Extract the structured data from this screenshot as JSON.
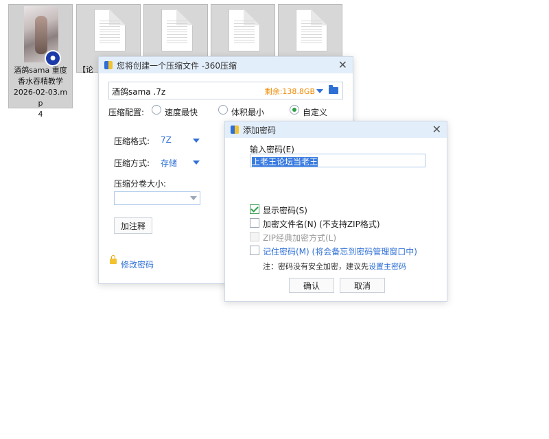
{
  "desktop": {
    "selected_file": {
      "caption_line1": "酒鸽sama 重度",
      "caption_line2": "香水吞精教学",
      "caption_line3": "2026-02-03.mp",
      "caption_line4": "4",
      "icon": "video-thumbnail"
    },
    "doc_tile_partial_caption": "【论",
    "doc_tiles": 4
  },
  "compress_dialog": {
    "title": "您将创建一个压缩文件 -360压缩",
    "archive_name": "酒鸽sama .7z",
    "free_space": "剩余:138.8GB",
    "config_label": "压缩配置:",
    "options": [
      "速度最快",
      "体积最小",
      "自定义"
    ],
    "selected_option": "自定义",
    "format_label": "压缩格式:",
    "format_value": "7Z",
    "method_label": "压缩方式:",
    "method_value": "存储",
    "volume_label": "压缩分卷大小:",
    "volume_value": "",
    "comment_button": "加注释",
    "modify_password": "修改密码"
  },
  "password_dialog": {
    "title": "添加密码",
    "prompt": "输入密码(E)",
    "password_value": "上老王论坛当老王",
    "show_password": "显示密码(S)",
    "show_password_checked": true,
    "encrypt_filename": "加密文件名(N) (不支持ZIP格式)",
    "encrypt_filename_checked": false,
    "zip_classic": "ZIP经典加密方式(L)",
    "zip_classic_enabled": false,
    "remember_password": "记住密码(M) (将会备忘到密码管理窗口中)",
    "remember_checked": false,
    "note_prefix": "注：密码没有安全加密，建议先",
    "note_link": "设置主密码",
    "ok": "确认",
    "cancel": "取消"
  },
  "colors": {
    "accent": "#2e6fd6",
    "free_space": "#f08a00",
    "titlebar": "#e3eefb",
    "check_green": "#2ea048"
  }
}
